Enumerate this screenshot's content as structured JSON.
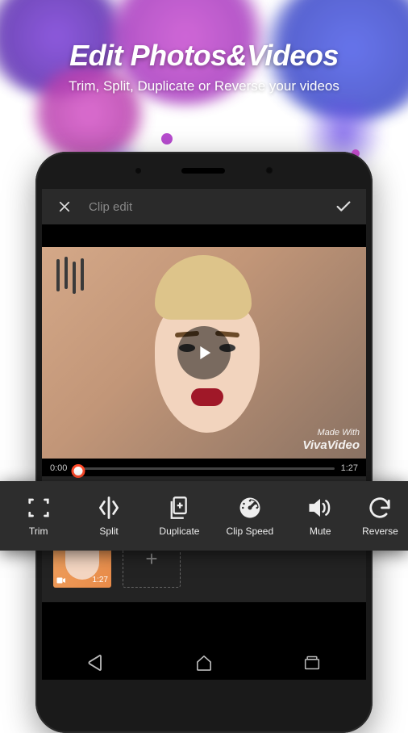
{
  "promo": {
    "title": "Edit Photos&Videos",
    "subtitle": "Trim, Split, Duplicate or Reverse your videos"
  },
  "topbar": {
    "title": "Clip edit"
  },
  "preview": {
    "watermark_line1": "Made With",
    "watermark_line2": "VivaVideo"
  },
  "timeline": {
    "current": "0:00",
    "total": "1:27"
  },
  "tools": [
    {
      "id": "trim",
      "label": "Trim"
    },
    {
      "id": "split",
      "label": "Split"
    },
    {
      "id": "duplicate",
      "label": "Duplicate"
    },
    {
      "id": "clip-speed",
      "label": "Clip Speed"
    },
    {
      "id": "mute",
      "label": "Mute"
    },
    {
      "id": "reverse",
      "label": "Reverse"
    }
  ],
  "clips": [
    {
      "duration": "1:27",
      "type": "video"
    }
  ],
  "add_label": "+"
}
